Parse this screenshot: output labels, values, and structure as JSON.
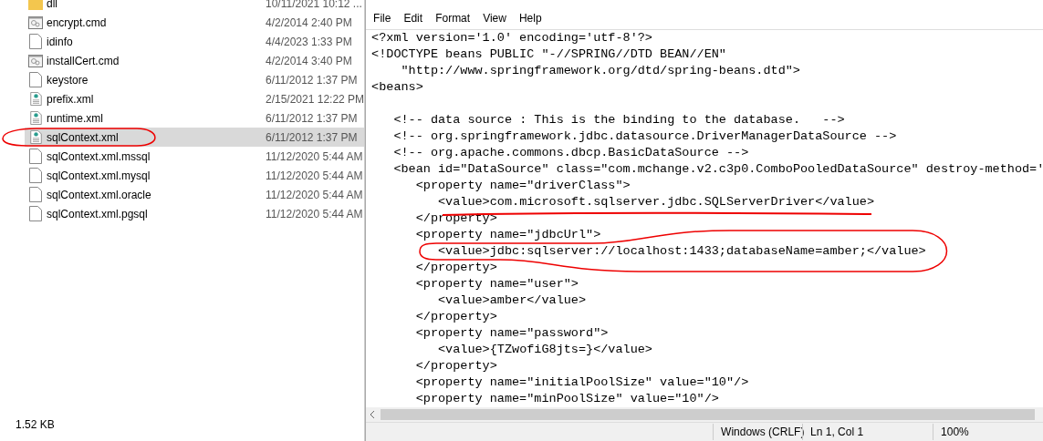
{
  "explorer": {
    "files": [
      {
        "name": "dll",
        "date": "10/11/2021 10:12 ...",
        "kind": "folder",
        "selected": false
      },
      {
        "name": "encrypt.cmd",
        "date": "4/2/2014 2:40 PM",
        "kind": "cmd",
        "selected": false
      },
      {
        "name": "idinfo",
        "date": "4/4/2023 1:33 PM",
        "kind": "file",
        "selected": false
      },
      {
        "name": "installCert.cmd",
        "date": "4/2/2014 3:40 PM",
        "kind": "cmd",
        "selected": false
      },
      {
        "name": "keystore",
        "date": "6/11/2012 1:37 PM",
        "kind": "file",
        "selected": false
      },
      {
        "name": "prefix.xml",
        "date": "2/15/2021 12:22 PM",
        "kind": "xml",
        "selected": false
      },
      {
        "name": "runtime.xml",
        "date": "6/11/2012 1:37 PM",
        "kind": "xml",
        "selected": false
      },
      {
        "name": "sqlContext.xml",
        "date": "6/11/2012 1:37 PM",
        "kind": "xml",
        "selected": true
      },
      {
        "name": "sqlContext.xml.mssql",
        "date": "11/12/2020 5:44 AM",
        "kind": "file",
        "selected": false
      },
      {
        "name": "sqlContext.xml.mysql",
        "date": "11/12/2020 5:44 AM",
        "kind": "file",
        "selected": false
      },
      {
        "name": "sqlContext.xml.oracle",
        "date": "11/12/2020 5:44 AM",
        "kind": "file",
        "selected": false
      },
      {
        "name": "sqlContext.xml.pgsql",
        "date": "11/12/2020 5:44 AM",
        "kind": "file",
        "selected": false
      }
    ],
    "status_bar": {
      "size": "1.52 KB"
    }
  },
  "notepad": {
    "menu": [
      "File",
      "Edit",
      "Format",
      "View",
      "Help"
    ],
    "lines": [
      "<?xml version='1.0' encoding='utf-8'?>",
      "<!DOCTYPE beans PUBLIC \"-//SPRING//DTD BEAN//EN\"",
      "    \"http://www.springframework.org/dtd/spring-beans.dtd\">",
      "<beans>"
    ],
    "body_lines": [
      "   <!-- data source : This is the binding to the database.   -->",
      "   <!-- org.springframework.jdbc.datasource.DriverManagerDataSource -->",
      "   <!-- org.apache.commons.dbcp.BasicDataSource -->",
      "   <bean id=\"DataSource\" class=\"com.mchange.v2.c3p0.ComboPooledDataSource\" destroy-method='",
      "      <property name=\"driverClass\">",
      "         <value>com.microsoft.sqlserver.jdbc.SQLServerDriver</value>",
      "      </property>",
      "      <property name=\"jdbcUrl\">",
      "         <value>jdbc:sqlserver://localhost:1433;databaseName=amber;</value>",
      "      </property>",
      "      <property name=\"user\">",
      "         <value>amber</value>",
      "      </property>",
      "      <property name=\"password\">",
      "         <value>{TZwofiG8jts=}</value>",
      "      </property>",
      "      <property name=\"initialPoolSize\" value=\"10\"/>",
      "      <property name=\"minPoolSize\" value=\"10\"/>"
    ],
    "status_bar": {
      "line_ending": "Windows (CRLF)",
      "position": "Ln 1, Col 1",
      "zoom": "100%"
    }
  }
}
